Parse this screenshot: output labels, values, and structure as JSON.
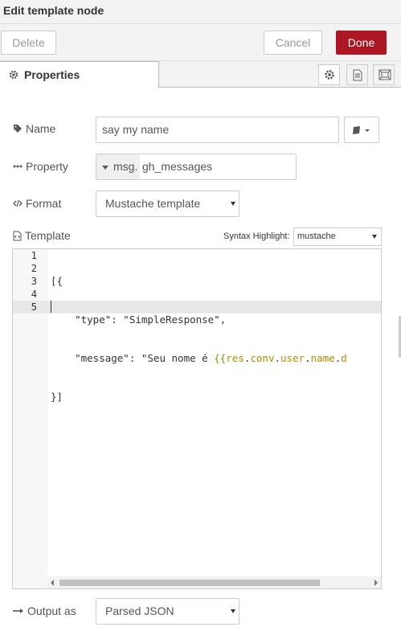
{
  "window": {
    "title": "Edit template node"
  },
  "toolbar": {
    "delete_label": "Delete",
    "cancel_label": "Cancel",
    "done_label": "Done",
    "done_color": "#ad1625"
  },
  "tabs": {
    "properties_label": "Properties",
    "icons": [
      "gear-icon",
      "description-icon",
      "appearance-icon"
    ]
  },
  "form": {
    "name": {
      "label": "Name",
      "value": "say my name"
    },
    "property": {
      "label": "Property",
      "prefix": "msg.",
      "value": "gh_messages"
    },
    "format": {
      "label": "Format",
      "value": "Mustache template"
    },
    "template": {
      "label": "Template",
      "syntax_label": "Syntax Highlight:",
      "syntax_value": "mustache"
    },
    "output": {
      "label": "Output as",
      "value": "Parsed JSON"
    }
  },
  "editor": {
    "line_numbers": [
      "1",
      "2",
      "3",
      "4",
      "5"
    ],
    "active_line": "5",
    "lines": {
      "l1": "[{",
      "l2": "    \"type\": \"SimpleResponse\",",
      "l3_prefix": "    \"message\": \"Seu nome é ",
      "l3_open": "{{",
      "l3_res": "res",
      "l3_conv": "conv",
      "l3_user": "user",
      "l3_name": "name",
      "l3_tail": "d",
      "l3_dot": ".",
      "l4": "}]",
      "l5": ""
    }
  }
}
